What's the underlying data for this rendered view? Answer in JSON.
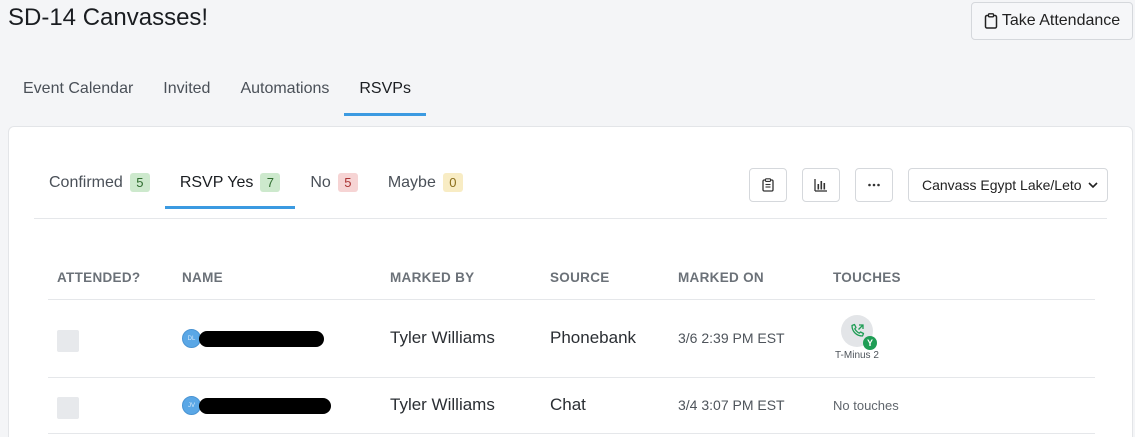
{
  "page": {
    "title": "SD-14 Canvasses!",
    "take_attendance_label": "Take Attendance"
  },
  "main_tabs": [
    {
      "label": "Event Calendar"
    },
    {
      "label": "Invited"
    },
    {
      "label": "Automations"
    },
    {
      "label": "RSVPs",
      "active": true
    }
  ],
  "sub_tabs": [
    {
      "label": "Confirmed",
      "count": "5",
      "color": "green"
    },
    {
      "label": "RSVP Yes",
      "count": "7",
      "color": "green",
      "active": true
    },
    {
      "label": "No",
      "count": "5",
      "color": "red"
    },
    {
      "label": "Maybe",
      "count": "0",
      "color": "yellow"
    }
  ],
  "toolbar": {
    "icons": [
      "clipboard-icon",
      "bar-chart-icon",
      "more-icon"
    ],
    "event_select": "Canvass Egypt Lake/Leto"
  },
  "table": {
    "headers": [
      "ATTENDED?",
      "NAME",
      "MARKED BY",
      "SOURCE",
      "MARKED ON",
      "TOUCHES"
    ],
    "rows": [
      {
        "initials": "DL",
        "marked_by": "Tyler Williams",
        "source": "Phonebank",
        "marked_on": "3/6 2:39 PM EST",
        "touch_badge": "Y",
        "touch_label": "T-Minus 2"
      },
      {
        "initials": "JV",
        "marked_by": "Tyler Williams",
        "source": "Chat",
        "marked_on": "3/4 3:07 PM EST",
        "touches_text": "No touches"
      }
    ]
  },
  "colors": {
    "accent": "#3b9ae1",
    "badge_green": "#1f9d55"
  }
}
